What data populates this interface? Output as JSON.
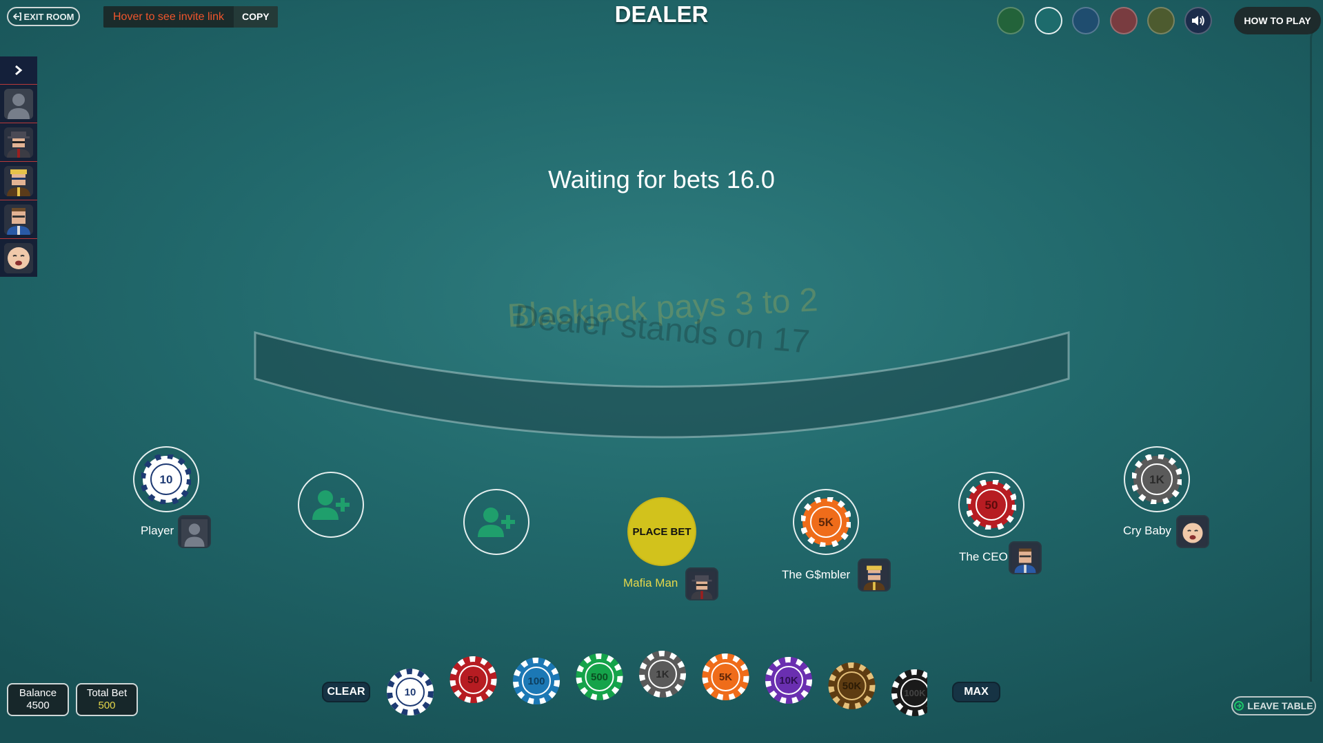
{
  "header": {
    "exit_label": "EXIT ROOM",
    "invite_text": "Hover to see invite link",
    "copy_label": "COPY",
    "title": "DEALER",
    "how_to_play": "HOW TO PLAY",
    "theme_colors": [
      "#23633a",
      "#1d6b6c",
      "#1f4d6f",
      "#793c40",
      "#4d5b2f"
    ]
  },
  "status": "Waiting for bets 16.0",
  "felt": {
    "line1": "Blackjack pays 3 to 2",
    "line2": "Dealer stands on 17"
  },
  "seats": {
    "player": {
      "name": "Player",
      "chip": "10"
    },
    "empty1": {
      "icon": "add-user-icon"
    },
    "empty2": {
      "icon": "add-user-icon"
    },
    "mafia": {
      "name": "Mafia Man",
      "action": "PLACE BET"
    },
    "gambler": {
      "name": "The G$mbler",
      "chip": "5K"
    },
    "ceo": {
      "name": "The CEO",
      "chip": "50"
    },
    "crybaby": {
      "name": "Cry Baby",
      "chip": "1K"
    }
  },
  "balance": {
    "label": "Balance",
    "value": "4500"
  },
  "total_bet": {
    "label": "Total Bet",
    "value": "500"
  },
  "controls": {
    "clear": "CLEAR",
    "max": "MAX",
    "leave": "LEAVE TABLE"
  },
  "chips": [
    {
      "label": "10",
      "color": "#ffffff",
      "text": "#1e3a73",
      "accent": "#1e3a73"
    },
    {
      "label": "50",
      "color": "#b71c22",
      "text": "#5a0b0b",
      "accent": "#ffffff"
    },
    {
      "label": "100",
      "color": "#1c78b5",
      "text": "#0d3e5e",
      "accent": "#ffffff"
    },
    {
      "label": "500",
      "color": "#15a34a",
      "text": "#0b4d22",
      "accent": "#ffffff"
    },
    {
      "label": "1K",
      "color": "#5a5a5a",
      "text": "#2a2a2a",
      "accent": "#ffffff"
    },
    {
      "label": "5K",
      "color": "#ef6c1a",
      "text": "#5e2608",
      "accent": "#ffffff"
    },
    {
      "label": "10K",
      "color": "#6a2fb0",
      "text": "#2e0f52",
      "accent": "#ffffff"
    },
    {
      "label": "50K",
      "color": "#5e3c12",
      "text": "#2c1b05",
      "accent": "#e5c07a"
    },
    {
      "label": "100K",
      "color": "#1a1a1a",
      "text": "#444444",
      "accent": "#ffffff"
    }
  ]
}
